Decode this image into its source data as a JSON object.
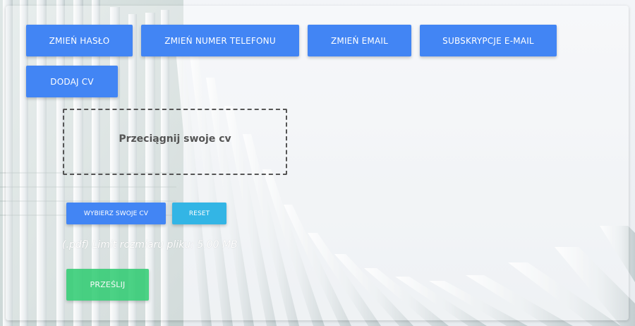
{
  "colors": {
    "primary": "#4285f4",
    "info": "#33b5e5",
    "success": "#2ecc71",
    "dropzone_border": "#555555"
  },
  "account_menu": {
    "change_password": "ZMIEŃ HASŁO",
    "change_phone": "ZMIEŃ NUMER TELEFONU",
    "change_email": "ZMIEŃ EMAIL",
    "email_subscriptions": "SUBSKRYPCJE E-MAIL",
    "add_cv": "DODAJ CV"
  },
  "upload": {
    "dropzone_label": "Przeciągnij swoje cv",
    "choose_button": "WYBIERZ SWOJE CV",
    "reset_button": "RESET",
    "file_hint": "(.pdf) Limit rozmiaru pliku: 5.00 MB",
    "submit_button": "PRZEŚLIJ"
  }
}
